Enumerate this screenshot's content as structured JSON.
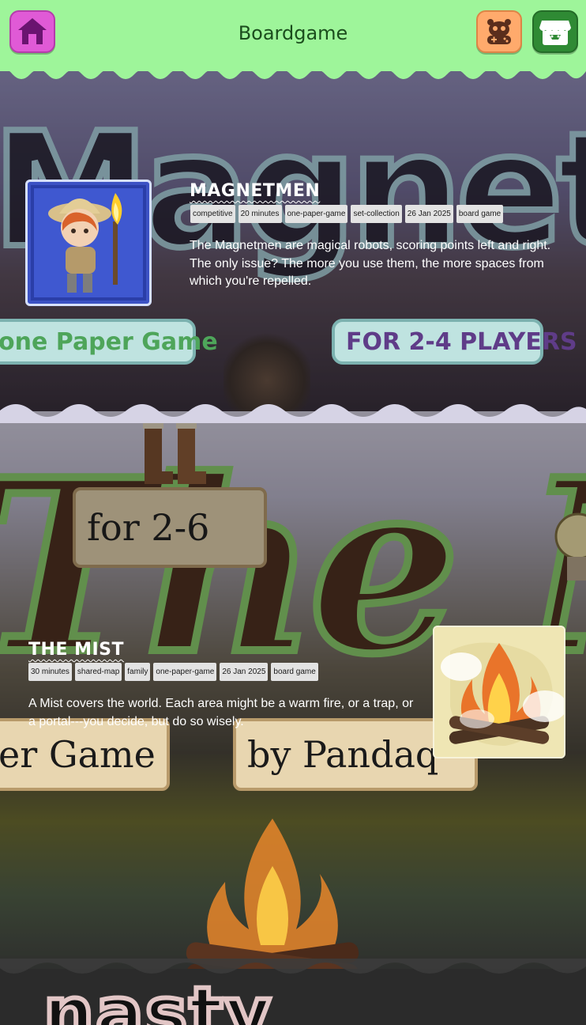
{
  "header": {
    "title": "Boardgame",
    "home_icon": "house-icon",
    "games_icon": "gamepad-creature-icon",
    "itch_icon": "itchio-store-icon",
    "colors": {
      "bar": "#9ef59a",
      "home": "#e05ad6",
      "games": "#ffaa6c",
      "itch": "#2f8a34"
    }
  },
  "backgrounds": {
    "magnetmen": {
      "big_text": "Magnetm",
      "banner_left": "one Paper Game",
      "banner_right": "FOR 2-4 PLAYERS"
    },
    "mist": {
      "big_text": "The M",
      "plaque_players": "for 2-6",
      "plaque_left": "er Game",
      "plaque_right": "by Pandaq"
    },
    "next": {
      "big_text": "nasty"
    }
  },
  "games": [
    {
      "title": "MAGNETMEN",
      "tags": [
        "competitive",
        "20 minutes",
        "one-paper-game",
        "set-collection",
        "26 Jan 2025",
        "board game"
      ],
      "description": "The Magnetmen are magical robots, scoring points left and right. The only issue? The more you use them, the more spaces from which you're repelled.",
      "thumbnail_icon": "explorer-character-icon"
    },
    {
      "title": "THE MIST",
      "tags": [
        "30 minutes",
        "shared-map",
        "family",
        "one-paper-game",
        "26 Jan 2025",
        "board game"
      ],
      "description": "A Mist covers the world. Each area might be a warm fire, or a trap, or a portal---you decide, but do so wisely.",
      "thumbnail_icon": "campfire-icon"
    }
  ]
}
